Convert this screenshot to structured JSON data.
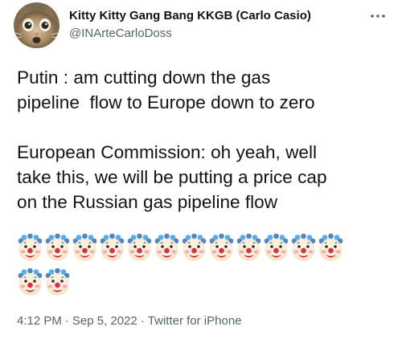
{
  "author": {
    "display_name": "Kitty Kitty Gang Bang KKGB (Carlo Casio)",
    "handle": "@INArteCarloDoss",
    "avatar_icon": "cat-face-avatar"
  },
  "menu": {
    "icon": "more-dots-icon"
  },
  "tweet": {
    "text": "Putin : am cutting down the gas\npipeline  flow to Europe down to zero\n\nEuropean Commission: oh yeah, well\ntake this, we will be putting a price cap\non the Russian gas pipeline flow",
    "emoji_name": "clown-face-emoji",
    "emoji_rows": [
      12,
      2
    ]
  },
  "meta": {
    "time": "4:12 PM",
    "separator": "·",
    "date": "Sep 5, 2022",
    "source": "Twitter for iPhone"
  },
  "colors": {
    "text_primary": "#0f1419",
    "text_secondary": "#536471"
  }
}
